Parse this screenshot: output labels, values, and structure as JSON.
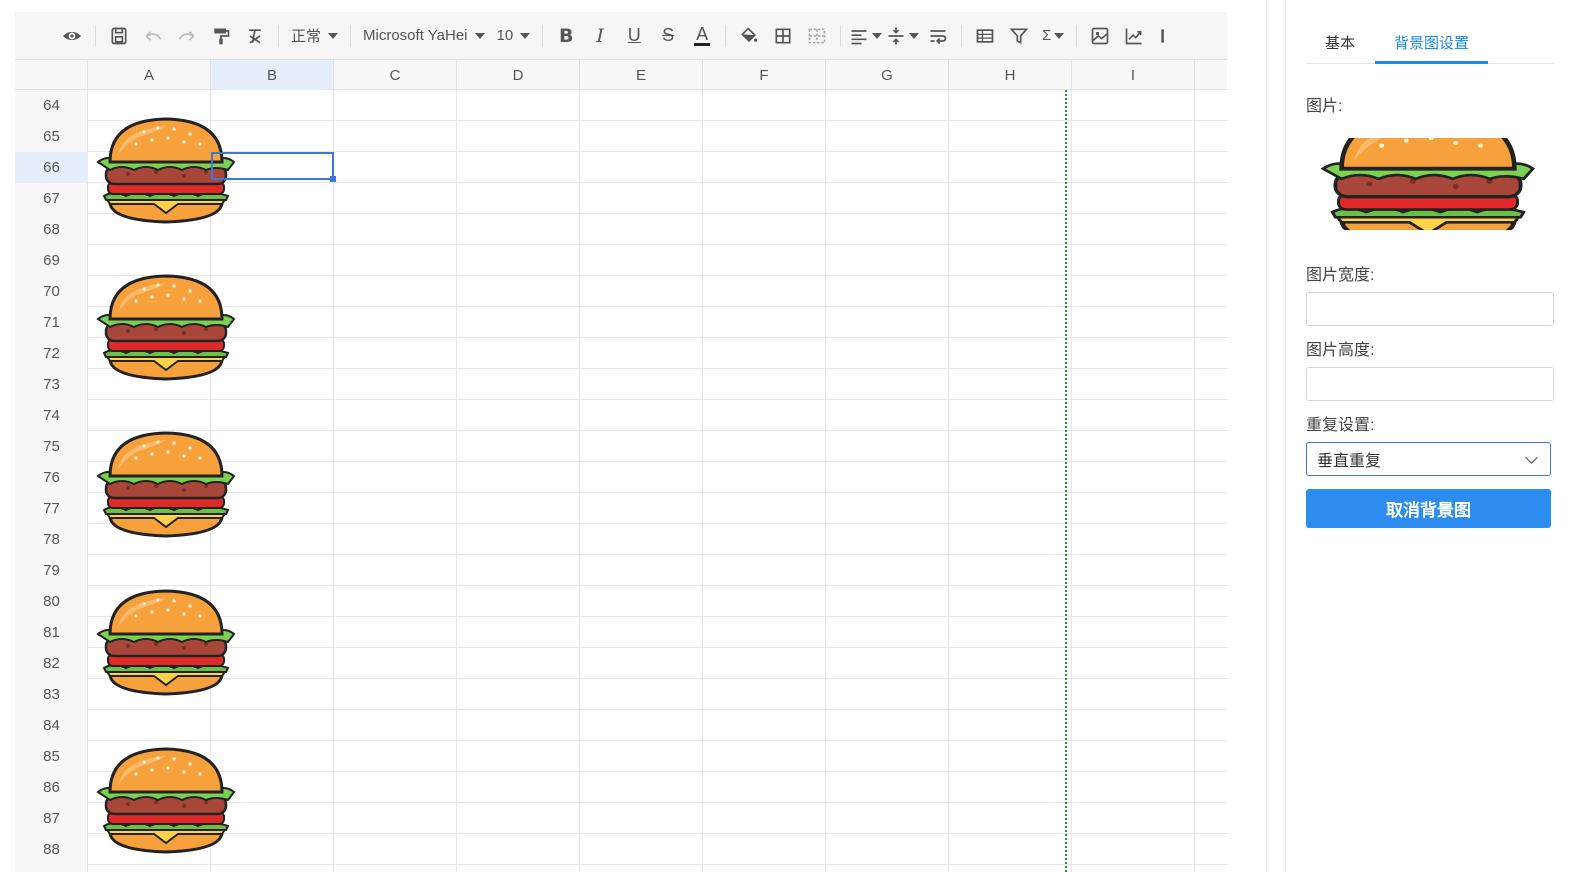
{
  "toolbar": {
    "paint_format_label": "正常",
    "font_family": "Microsoft YaHei",
    "font_size": "10",
    "icons": [
      "eye-icon",
      "save-icon",
      "undo-icon",
      "redo-icon",
      "format-painter-icon",
      "clear-format-icon",
      "bold-icon",
      "italic-icon",
      "underline-icon",
      "strikethrough-icon",
      "font-color-icon",
      "fill-color-icon",
      "border-icon",
      "merge-cells-icon",
      "align-icon",
      "valign-icon",
      "wrap-text-icon",
      "freeze-icon",
      "filter-icon",
      "sum-icon",
      "image-icon",
      "chart-icon"
    ],
    "bold_glyph": "B",
    "italic_glyph": "I",
    "underline_glyph": "U",
    "strike_glyph": "S",
    "font_color_glyph": "A",
    "sum_glyph": "Σ"
  },
  "sheet": {
    "columns": [
      "A",
      "B",
      "C",
      "D",
      "E",
      "F",
      "G",
      "H",
      "I"
    ],
    "rows": [
      "64",
      "65",
      "66",
      "67",
      "68",
      "69",
      "70",
      "71",
      "72",
      "73",
      "74",
      "75",
      "76",
      "77",
      "78",
      "79",
      "80",
      "81",
      "82",
      "83",
      "84",
      "85",
      "86",
      "87",
      "88"
    ],
    "active_cell": "B66",
    "background_image": "burger-image"
  },
  "panel": {
    "tabs": [
      "基本",
      "背景图设置"
    ],
    "active_tab": "背景图设置",
    "image_label": "图片:",
    "width_label": "图片宽度:",
    "width_value": "",
    "height_label": "图片高度:",
    "height_value": "",
    "repeat_label": "重复设置:",
    "repeat_value": "垂直重复",
    "cancel_button": "取消背景图"
  },
  "colors": {
    "accent": "#1e88e5",
    "button": "#2d8cf0",
    "selection": "#3c78d8",
    "page_break": "#1a9a3a"
  }
}
